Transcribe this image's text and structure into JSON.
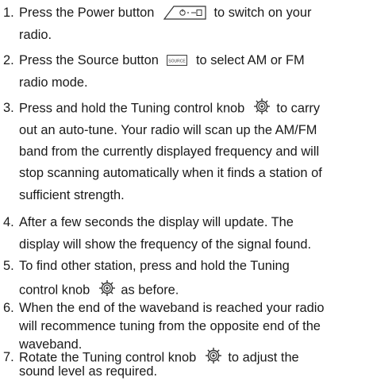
{
  "steps": [
    {
      "number": "1.",
      "parts": [
        "Press the Power button",
        "to switch on your",
        "radio."
      ]
    },
    {
      "number": "2.",
      "parts": [
        "Press the Source button",
        "to select AM or FM",
        "radio mode."
      ]
    },
    {
      "number": "3.",
      "parts": [
        "Press and hold the Tuning control knob",
        "to carry",
        "out an auto-tune. Your radio will scan up the AM/FM",
        "band from the currently displayed frequency and will",
        "stop scanning automatically when it finds a station of",
        "sufficient strength."
      ]
    },
    {
      "number": "4.",
      "parts": [
        "After a few seconds the display will update. The",
        "display will show the frequency of the signal found."
      ]
    },
    {
      "number": "5.",
      "parts": [
        "To find other station, press and hold the Tuning",
        "control knob",
        "as before."
      ]
    },
    {
      "number": "6.",
      "parts": [
        "When the end of the waveband is reached your radio",
        "will recommence tuning from the opposite end of the",
        "waveband."
      ]
    },
    {
      "number": "7.",
      "parts": [
        "Rotate the Tuning control knob",
        "to adjust the",
        "sound level as required."
      ]
    }
  ],
  "icons": {
    "power_button_label": "⏻•⏏",
    "source_button_label": "SOURCE"
  }
}
